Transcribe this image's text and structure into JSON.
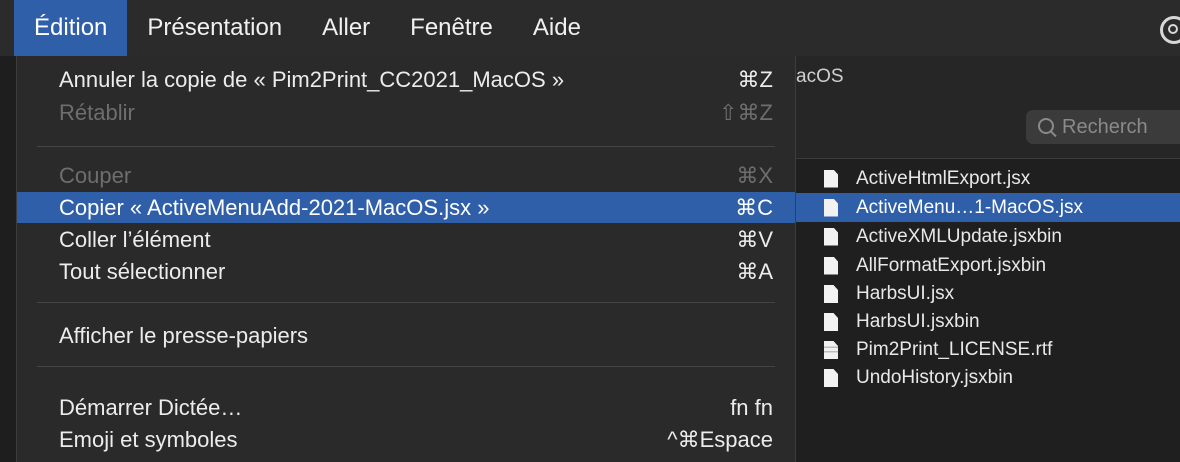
{
  "menubar": {
    "items": [
      "Édition",
      "Présentation",
      "Aller",
      "Fenêtre",
      "Aide"
    ],
    "active_index": 0
  },
  "edit_menu": {
    "items": [
      {
        "label": "Annuler la copie de « Pim2Print_CC2021_MacOS »",
        "shortcut": "⌘Z",
        "enabled": true
      },
      {
        "label": "Rétablir",
        "shortcut": "⇧⌘Z",
        "enabled": false
      },
      {
        "label": "Couper",
        "shortcut": "⌘X",
        "enabled": false
      },
      {
        "label": "Copier « ActiveMenuAdd-2021-MacOS.jsx »",
        "shortcut": "⌘C",
        "enabled": true,
        "highlighted": true
      },
      {
        "label": "Coller l’élément",
        "shortcut": "⌘V",
        "enabled": true
      },
      {
        "label": "Tout sélectionner",
        "shortcut": "⌘A",
        "enabled": true
      },
      {
        "label": "Afficher le presse-papiers",
        "shortcut": "",
        "enabled": true
      },
      {
        "label": "Démarrer Dictée…",
        "shortcut": "fn fn",
        "enabled": true
      },
      {
        "label": "Emoji et symboles",
        "shortcut": "^⌘Espace",
        "enabled": true
      }
    ]
  },
  "finder": {
    "title_fragment": "acOS",
    "search_placeholder": "Recherch",
    "files": [
      {
        "name": "ActiveHtmlExport.jsx",
        "selected": false,
        "icon": "document-icon"
      },
      {
        "name": "ActiveMenu…1-MacOS.jsx",
        "selected": true,
        "icon": "document-icon"
      },
      {
        "name": "ActiveXMLUpdate.jsxbin",
        "selected": false,
        "icon": "document-icon"
      },
      {
        "name": "AllFormatExport.jsxbin",
        "selected": false,
        "icon": "document-icon"
      },
      {
        "name": "HarbsUI.jsx",
        "selected": false,
        "icon": "document-icon"
      },
      {
        "name": "HarbsUI.jsxbin",
        "selected": false,
        "icon": "document-icon"
      },
      {
        "name": "Pim2Print_LICENSE.rtf",
        "selected": false,
        "icon": "rtf-document-icon"
      },
      {
        "name": "UndoHistory.jsxbin",
        "selected": false,
        "icon": "document-icon"
      }
    ]
  },
  "colors": {
    "accent": "#2f5fa8",
    "menu_bg": "#2a2a2a",
    "menubar_bg": "#2b2b2b",
    "disabled_text": "#6e6e6e"
  }
}
